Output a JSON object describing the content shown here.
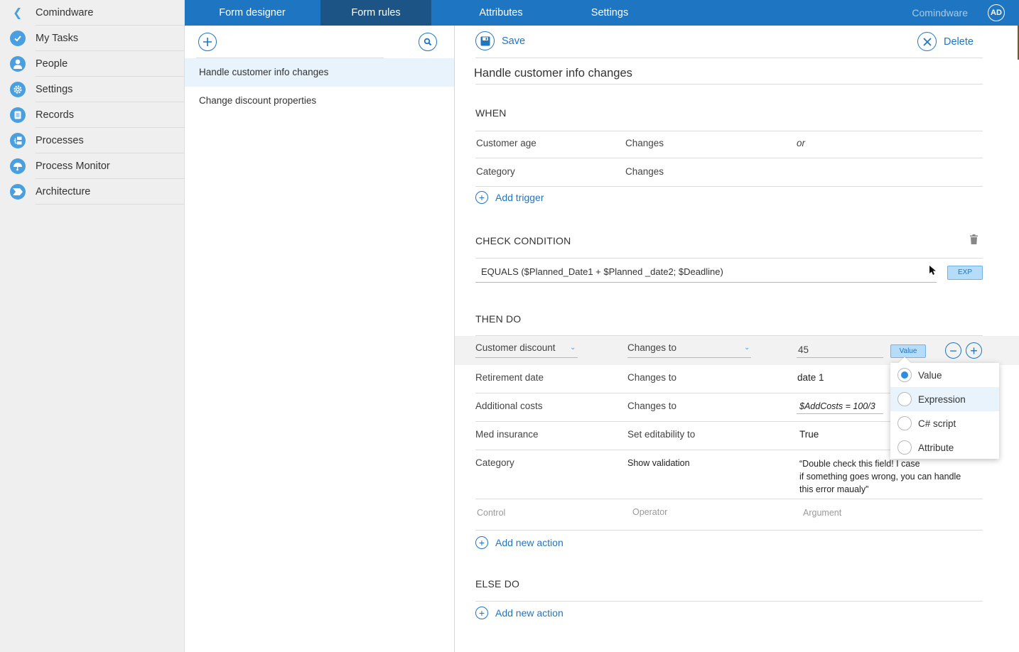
{
  "sidebar": {
    "back_label": "Comindware",
    "items": [
      {
        "label": "My Tasks",
        "icon": "check-icon"
      },
      {
        "label": "People",
        "icon": "person-icon"
      },
      {
        "label": "Settings",
        "icon": "gear-icon"
      },
      {
        "label": "Records",
        "icon": "document-icon"
      },
      {
        "label": "Processes",
        "icon": "process-icon"
      },
      {
        "label": "Process Monitor",
        "icon": "gauge-icon"
      },
      {
        "label": "Architecture",
        "icon": "architecture-icon"
      }
    ]
  },
  "topbar": {
    "tabs": [
      {
        "label": "Form designer",
        "active": false
      },
      {
        "label": "Form rules",
        "active": true
      },
      {
        "label": "Attributes",
        "active": false
      },
      {
        "label": "Settings",
        "active": false
      }
    ],
    "brand": "Comindware",
    "avatar_initials": "AD",
    "accent_color": "#1e76c3",
    "active_tab_color": "#1b5485"
  },
  "rules_list": {
    "items": [
      {
        "label": "Handle customer info changes",
        "selected": true
      },
      {
        "label": "Change discount properties",
        "selected": false
      }
    ]
  },
  "editor": {
    "save_label": "Save",
    "delete_label": "Delete",
    "rule_name": "Handle customer info changes",
    "when": {
      "title": "WHEN",
      "triggers": [
        {
          "field": "Customer age",
          "event": "Changes",
          "connector": "or"
        },
        {
          "field": "Category",
          "event": "Changes",
          "connector": ""
        }
      ],
      "add_label": "Add trigger"
    },
    "condition": {
      "title": "CHECK CONDITION",
      "expression": "EQUALS ($Planned_Date1 + $Planned _date2; $Deadline)",
      "mode_button": "EXP"
    },
    "then": {
      "title": "THEN DO",
      "active_action": {
        "control": "Customer discount",
        "operator": "Changes to",
        "argument": "45",
        "mode_button": "Value"
      },
      "actions": [
        {
          "control": "Retirement date",
          "operator": "Changes to",
          "argument": "date 1"
        },
        {
          "control": "Additional costs",
          "operator": "Changes to",
          "argument": "$AddCosts = 100/3"
        },
        {
          "control": "Med insurance",
          "operator": "Set editability to",
          "argument": "True"
        },
        {
          "control": "Category",
          "operator": "Show validation",
          "argument_lines": [
            "“Double check this field! I case",
            "if something goes wrong, you can handle",
            "this error maualy”"
          ]
        }
      ],
      "placeholders": {
        "control": "Control",
        "operator": "Operator",
        "argument": "Argument"
      },
      "add_label": "Add new action"
    },
    "else": {
      "title": "ELSE DO",
      "add_label": "Add new action"
    }
  },
  "mode_dropdown": {
    "options": [
      {
        "label": "Value",
        "checked": true,
        "highlighted": false
      },
      {
        "label": "Expression",
        "checked": false,
        "highlighted": true
      },
      {
        "label": "C# script",
        "checked": false,
        "highlighted": false
      },
      {
        "label": "Attribute",
        "checked": false,
        "highlighted": false
      }
    ]
  }
}
